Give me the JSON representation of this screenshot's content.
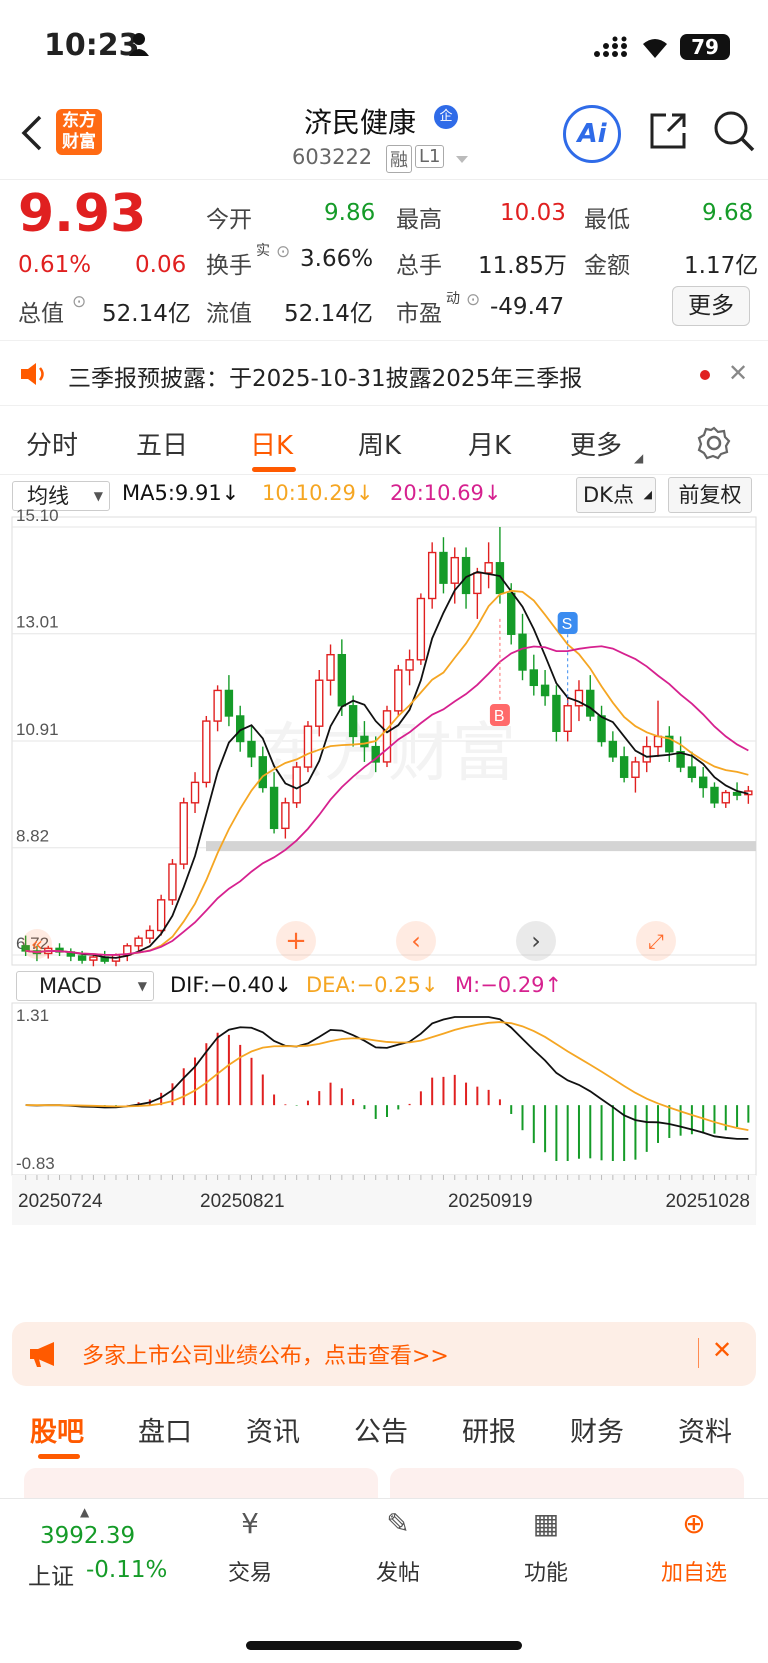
{
  "status": {
    "time": "10:23",
    "battery": "79"
  },
  "header": {
    "title": "济民健康",
    "code": "603222",
    "tag_rong": "融",
    "tag_l1": "L1",
    "ai_label": "Ai"
  },
  "quote": {
    "price": "9.93",
    "pct": "0.61%",
    "chg": "0.06",
    "open_label": "今开",
    "open": "9.86",
    "high_label": "最高",
    "high": "10.03",
    "low_label": "最低",
    "low": "9.68",
    "turnover_label": "换手",
    "turnover_sup": "实",
    "turnover": "3.66%",
    "volume_label": "总手",
    "volume": "11.85万",
    "amount_label": "金额",
    "amount": "1.17亿",
    "mktcap_label": "总值",
    "mktcap": "52.14亿",
    "float_label": "流值",
    "float": "52.14亿",
    "pe_label": "市盈",
    "pe_sup": "动",
    "pe": "-49.47",
    "more": "更多"
  },
  "notice": {
    "text": "三季报预披露：于2025-10-31披露2025年三季报"
  },
  "tabs": [
    "分时",
    "五日",
    "日K",
    "周K",
    "月K",
    "更多"
  ],
  "indicator": {
    "ma_select": "均线",
    "ma5": "MA5:9.91↓",
    "ma10": "10:10.29↓",
    "ma20": "20:10.69↓",
    "dk": "DK点",
    "adjust": "前复权",
    "macd_select": "MACD",
    "dif": "DIF:−0.40↓",
    "dea": "DEA:−0.25↓",
    "m": "M:−0.29↑"
  },
  "colors": {
    "up": "#e02020",
    "down": "#159b28",
    "ma5": "#111111",
    "ma10": "#f5a623",
    "ma20": "#d6218f",
    "accent": "#ff5a00"
  },
  "chart_data": {
    "type": "candlestick",
    "y_ticks": [
      "15.10",
      "13.01",
      "10.91",
      "8.82",
      "6.72"
    ],
    "ylim": [
      6.72,
      15.1
    ],
    "macd_ticks": [
      "1.31",
      "-0.83"
    ],
    "x_dates": [
      "20250724",
      "20250821",
      "20250919",
      "20251028"
    ],
    "markers": [
      "B",
      "S"
    ],
    "candles": [
      [
        6.9,
        7.1,
        6.7,
        6.8
      ],
      [
        6.8,
        6.9,
        6.6,
        6.75
      ],
      [
        6.75,
        6.9,
        6.65,
        6.85
      ],
      [
        6.85,
        6.95,
        6.7,
        6.78
      ],
      [
        6.78,
        6.85,
        6.6,
        6.7
      ],
      [
        6.7,
        6.8,
        6.55,
        6.62
      ],
      [
        6.62,
        6.75,
        6.5,
        6.68
      ],
      [
        6.68,
        6.8,
        6.55,
        6.6
      ],
      [
        6.6,
        6.75,
        6.5,
        6.72
      ],
      [
        6.72,
        6.95,
        6.6,
        6.9
      ],
      [
        6.9,
        7.1,
        6.8,
        7.05
      ],
      [
        7.05,
        7.3,
        6.95,
        7.2
      ],
      [
        7.2,
        7.9,
        7.1,
        7.8
      ],
      [
        7.8,
        8.6,
        7.7,
        8.5
      ],
      [
        8.5,
        9.8,
        8.4,
        9.7
      ],
      [
        9.7,
        10.3,
        9.5,
        10.1
      ],
      [
        10.1,
        11.4,
        10.0,
        11.3
      ],
      [
        11.3,
        12.0,
        11.1,
        11.9
      ],
      [
        11.9,
        12.2,
        11.2,
        11.4
      ],
      [
        11.4,
        11.6,
        10.7,
        10.9
      ],
      [
        10.9,
        11.2,
        10.4,
        10.6
      ],
      [
        10.6,
        10.8,
        9.9,
        10.0
      ],
      [
        10.0,
        10.3,
        9.1,
        9.2
      ],
      [
        9.2,
        9.8,
        9.0,
        9.7
      ],
      [
        9.7,
        10.5,
        9.6,
        10.4
      ],
      [
        10.4,
        11.3,
        10.3,
        11.2
      ],
      [
        11.2,
        12.3,
        11.0,
        12.1
      ],
      [
        12.1,
        12.8,
        11.8,
        12.6
      ],
      [
        12.6,
        12.9,
        11.4,
        11.6
      ],
      [
        11.6,
        11.8,
        10.8,
        11.0
      ],
      [
        11.0,
        11.3,
        10.5,
        10.8
      ],
      [
        10.8,
        11.0,
        10.3,
        10.5
      ],
      [
        10.5,
        11.6,
        10.4,
        11.5
      ],
      [
        11.5,
        12.4,
        11.4,
        12.3
      ],
      [
        12.3,
        12.7,
        12.0,
        12.5
      ],
      [
        12.5,
        13.8,
        12.4,
        13.7
      ],
      [
        13.7,
        14.8,
        13.5,
        14.6
      ],
      [
        14.6,
        14.9,
        13.8,
        14.0
      ],
      [
        14.0,
        14.7,
        13.6,
        14.5
      ],
      [
        14.5,
        14.7,
        13.5,
        13.8
      ],
      [
        13.8,
        14.3,
        13.3,
        14.2
      ],
      [
        14.2,
        14.8,
        13.9,
        14.4
      ],
      [
        14.4,
        15.1,
        13.6,
        13.8
      ],
      [
        13.8,
        14.0,
        12.8,
        13.0
      ],
      [
        13.0,
        13.4,
        12.1,
        12.3
      ],
      [
        12.3,
        12.6,
        11.8,
        12.0
      ],
      [
        12.0,
        12.3,
        11.6,
        11.8
      ],
      [
        11.8,
        12.0,
        10.9,
        11.1
      ],
      [
        11.1,
        11.8,
        10.9,
        11.6
      ],
      [
        11.6,
        12.1,
        11.3,
        11.9
      ],
      [
        11.9,
        12.2,
        11.3,
        11.4
      ],
      [
        11.4,
        11.6,
        10.8,
        10.9
      ],
      [
        10.9,
        11.1,
        10.5,
        10.6
      ],
      [
        10.6,
        10.8,
        10.1,
        10.2
      ],
      [
        10.2,
        10.6,
        9.9,
        10.5
      ],
      [
        10.5,
        11.0,
        10.3,
        10.8
      ],
      [
        10.8,
        11.7,
        10.6,
        11.0
      ],
      [
        11.0,
        11.2,
        10.5,
        10.7
      ],
      [
        10.7,
        11.0,
        10.3,
        10.4
      ],
      [
        10.4,
        10.7,
        10.1,
        10.2
      ],
      [
        10.2,
        10.4,
        9.8,
        10.0
      ],
      [
        10.0,
        10.1,
        9.6,
        9.7
      ],
      [
        9.7,
        9.95,
        9.6,
        9.9
      ],
      [
        9.9,
        10.1,
        9.75,
        9.85
      ],
      [
        9.86,
        10.03,
        9.68,
        9.93
      ]
    ]
  },
  "banner": {
    "text": "多家上市公司业绩公布，点击查看>>"
  },
  "bottom_tabs": [
    "股吧",
    "盘口",
    "资讯",
    "公告",
    "研报",
    "财务",
    "资料"
  ],
  "bottom": {
    "index_value": "3992.39",
    "index_name": "上证",
    "index_pct": "-0.11%",
    "trade": "交易",
    "post": "发帖",
    "func": "功能",
    "add": "加自选"
  }
}
